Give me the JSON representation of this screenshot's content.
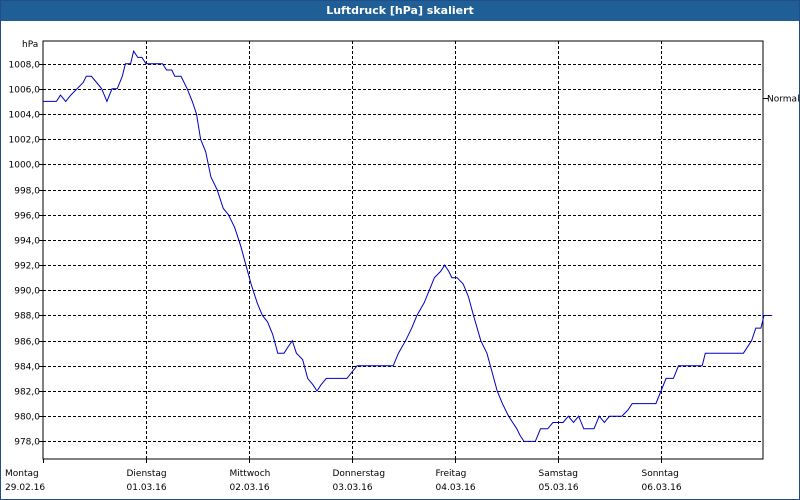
{
  "window": {
    "title": "Luftdruck [hPa] skaliert"
  },
  "chart_data": {
    "type": "line",
    "title": "Luftdruck [hPa] skaliert",
    "ylabel": "hPa",
    "ylim": [
      976.6,
      1009.8
    ],
    "grid": true,
    "y_ticks": [
      "1008,0",
      "1006,0",
      "1004,0",
      "1002,0",
      "1000,0",
      "998,0",
      "996,0",
      "994,0",
      "992,0",
      "990,0",
      "988,0",
      "986,0",
      "984,0",
      "982,0",
      "980,0",
      "978,0"
    ],
    "y_tick_values": [
      1008,
      1006,
      1004,
      1002,
      1000,
      998,
      996,
      994,
      992,
      990,
      988,
      986,
      984,
      982,
      980,
      978
    ],
    "x_ticks": [
      {
        "day": "Montag",
        "date": "29.02.16"
      },
      {
        "day": "Dienstag",
        "date": "01.03.16"
      },
      {
        "day": "Mittwoch",
        "date": "02.03.16"
      },
      {
        "day": "Donnerstag",
        "date": "03.03.16"
      },
      {
        "day": "Freitag",
        "date": "04.03.16"
      },
      {
        "day": "Samstag",
        "date": "05.03.16"
      },
      {
        "day": "Sonntag",
        "date": "06.03.16"
      }
    ],
    "xlim": [
      0,
      7.0
    ],
    "reference_line": {
      "label": "Normal",
      "value": 1005.3
    },
    "series": [
      {
        "color": "#0000c0",
        "points": [
          [
            0.0,
            1005.0
          ],
          [
            0.13,
            1005.0
          ],
          [
            0.17,
            1005.5
          ],
          [
            0.22,
            1005.0
          ],
          [
            0.27,
            1005.5
          ],
          [
            0.33,
            1006.0
          ],
          [
            0.39,
            1006.5
          ],
          [
            0.42,
            1007.0
          ],
          [
            0.47,
            1007.0
          ],
          [
            0.52,
            1006.5
          ],
          [
            0.57,
            1006.0
          ],
          [
            0.62,
            1005.0
          ],
          [
            0.67,
            1006.0
          ],
          [
            0.72,
            1006.0
          ],
          [
            0.77,
            1007.0
          ],
          [
            0.8,
            1008.0
          ],
          [
            0.85,
            1008.0
          ],
          [
            0.88,
            1009.0
          ],
          [
            0.92,
            1008.5
          ],
          [
            0.96,
            1008.5
          ],
          [
            1.0,
            1008.0
          ],
          [
            1.16,
            1008.0
          ],
          [
            1.2,
            1007.5
          ],
          [
            1.25,
            1007.5
          ],
          [
            1.28,
            1007.0
          ],
          [
            1.34,
            1007.0
          ],
          [
            1.4,
            1006.0
          ],
          [
            1.45,
            1005.0
          ],
          [
            1.49,
            1004.0
          ],
          [
            1.53,
            1002.0
          ],
          [
            1.58,
            1001.0
          ],
          [
            1.63,
            999.0
          ],
          [
            1.69,
            998.0
          ],
          [
            1.75,
            996.5
          ],
          [
            1.8,
            996.0
          ],
          [
            1.86,
            995.0
          ],
          [
            1.92,
            993.5
          ],
          [
            1.97,
            992.0
          ],
          [
            2.02,
            990.5
          ],
          [
            2.08,
            989.0
          ],
          [
            2.13,
            988.0
          ],
          [
            2.18,
            987.5
          ],
          [
            2.23,
            986.5
          ],
          [
            2.28,
            985.0
          ],
          [
            2.34,
            985.0
          ],
          [
            2.38,
            985.5
          ],
          [
            2.42,
            986.0
          ],
          [
            2.46,
            985.0
          ],
          [
            2.52,
            984.5
          ],
          [
            2.57,
            983.0
          ],
          [
            2.62,
            982.5
          ],
          [
            2.66,
            982.0
          ],
          [
            2.7,
            982.5
          ],
          [
            2.75,
            983.0
          ],
          [
            2.85,
            983.0
          ],
          [
            2.95,
            983.0
          ],
          [
            3.0,
            983.5
          ],
          [
            3.05,
            984.0
          ],
          [
            3.4,
            984.0
          ],
          [
            3.45,
            985.0
          ],
          [
            3.52,
            986.0
          ],
          [
            3.58,
            987.0
          ],
          [
            3.63,
            988.0
          ],
          [
            3.7,
            989.0
          ],
          [
            3.75,
            990.0
          ],
          [
            3.8,
            991.0
          ],
          [
            3.86,
            991.5
          ],
          [
            3.9,
            992.0
          ],
          [
            3.94,
            991.5
          ],
          [
            3.97,
            991.0
          ],
          [
            4.02,
            991.0
          ],
          [
            4.08,
            990.5
          ],
          [
            4.13,
            989.5
          ],
          [
            4.18,
            988.0
          ],
          [
            4.25,
            986.0
          ],
          [
            4.31,
            985.0
          ],
          [
            4.36,
            983.5
          ],
          [
            4.41,
            982.0
          ],
          [
            4.46,
            981.0
          ],
          [
            4.52,
            980.0
          ],
          [
            4.56,
            979.5
          ],
          [
            4.6,
            979.0
          ],
          [
            4.63,
            978.5
          ],
          [
            4.67,
            978.0
          ],
          [
            4.78,
            978.0
          ],
          [
            4.83,
            979.0
          ],
          [
            4.9,
            979.0
          ],
          [
            4.95,
            979.5
          ],
          [
            5.05,
            979.5
          ],
          [
            5.1,
            980.0
          ],
          [
            5.15,
            979.5
          ],
          [
            5.2,
            980.0
          ],
          [
            5.25,
            979.0
          ],
          [
            5.35,
            979.0
          ],
          [
            5.4,
            980.0
          ],
          [
            5.45,
            979.5
          ],
          [
            5.5,
            980.0
          ],
          [
            5.62,
            980.0
          ],
          [
            5.68,
            980.5
          ],
          [
            5.72,
            981.0
          ],
          [
            5.95,
            981.0
          ],
          [
            6.0,
            982.0
          ],
          [
            6.05,
            983.0
          ],
          [
            6.12,
            983.0
          ],
          [
            6.17,
            984.0
          ],
          [
            6.4,
            984.0
          ],
          [
            6.43,
            985.0
          ],
          [
            6.5,
            985.0
          ],
          [
            6.8,
            985.0
          ],
          [
            6.88,
            986.0
          ],
          [
            6.92,
            987.0
          ],
          [
            6.97,
            987.0
          ],
          [
            7.0,
            988.0
          ],
          [
            7.08,
            988.0
          ]
        ]
      }
    ]
  }
}
